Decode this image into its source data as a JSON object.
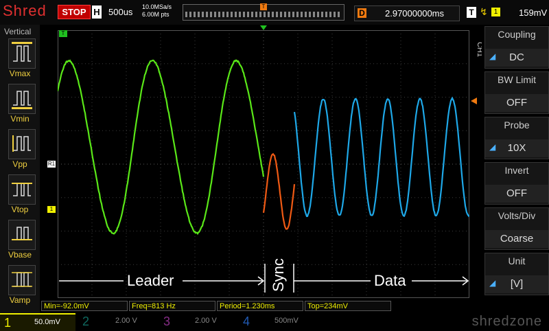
{
  "topbar": {
    "logo": "Shred",
    "run_status": "STOP",
    "timebase_badge": "H",
    "timebase": "500us",
    "sample_rate": "10.0MSa/s",
    "memory_depth": "6.00M pts",
    "trigger_marker": "T",
    "delay_badge": "D",
    "delay": "2.97000000ms",
    "trigger_badge": "T",
    "trigger_channel": "1",
    "trigger_level": "159mV"
  },
  "left_panel": {
    "title": "Vertical",
    "items": [
      {
        "label": "Vmax",
        "icon": "vmax-icon"
      },
      {
        "label": "Vmin",
        "icon": "vmin-icon"
      },
      {
        "label": "Vpp",
        "icon": "vpp-icon"
      },
      {
        "label": "Vtop",
        "icon": "vtop-icon"
      },
      {
        "label": "Vbase",
        "icon": "vbase-icon"
      },
      {
        "label": "Vamp",
        "icon": "vamp-icon"
      }
    ]
  },
  "right_panel": {
    "channel_tag": "CH1",
    "items": [
      {
        "title": "Coupling",
        "value": "DC",
        "arrow": true
      },
      {
        "title": "BW Limit",
        "value": "OFF",
        "arrow": false
      },
      {
        "title": "Probe",
        "value": "10X",
        "arrow": true
      },
      {
        "title": "Invert",
        "value": "OFF",
        "arrow": false
      },
      {
        "title": "Volts/Div",
        "value": "Coarse",
        "arrow": false
      },
      {
        "title": "Unit",
        "value": "[V]",
        "arrow": true
      }
    ]
  },
  "markers": {
    "trigger_top": "T",
    "channel_marker": "1",
    "ref_marker": "R1"
  },
  "annotations": {
    "leader": "Leader",
    "sync": "Sync",
    "data": "Data"
  },
  "measurements": [
    "Min=-92.0mV",
    "Freq=813 Hz",
    "Period=1.230ms",
    "Top=234mV"
  ],
  "channels": [
    {
      "num": "1",
      "scale": "50.0mV",
      "color": "#f0f000",
      "active": true
    },
    {
      "num": "2",
      "scale": "2.00 V",
      "color": "#1ab0a0",
      "active": false
    },
    {
      "num": "3",
      "scale": "2.00 V",
      "color": "#c040c0",
      "active": false
    },
    {
      "num": "4",
      "scale": "500mV",
      "color": "#3080ff",
      "active": false
    }
  ],
  "brand": "shredzone",
  "colors": {
    "leader_wave": "#5ae818",
    "sync_wave": "#f05a14",
    "data_wave": "#1ea8e8",
    "trigger_orange": "#f07a10",
    "stop_red": "#c00000"
  }
}
